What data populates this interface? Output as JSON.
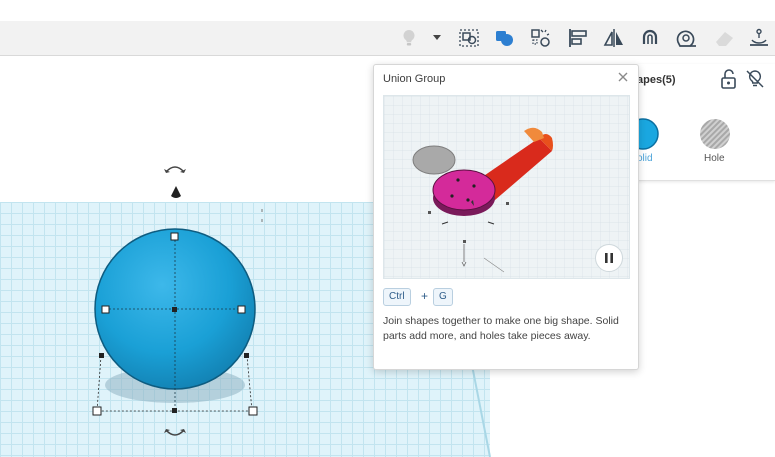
{
  "toolbar": {
    "icons": [
      "lightbulb-icon",
      "dropdown-caret-icon",
      "group-icon",
      "union-icon",
      "ungroup-icon",
      "align-icon",
      "mirror-icon",
      "magnet-icon",
      "ruler-icon",
      "eraser-icon",
      "anchor-icon"
    ]
  },
  "popup": {
    "title": "Union Group",
    "shortcut": {
      "key1": "Ctrl",
      "plus": "+",
      "key2": "G"
    },
    "description": "Join shapes together to make one big shape. Solid parts add more, and holes take pieces away."
  },
  "inspector": {
    "title": "apes(5)",
    "solid_label": "olid",
    "hole_label": "Hole"
  },
  "colors": {
    "sphere": "#1a9fd6",
    "accent": "#27a3dd",
    "toolbar_bg": "#f2f2f2",
    "grid": "#dff3fa"
  }
}
